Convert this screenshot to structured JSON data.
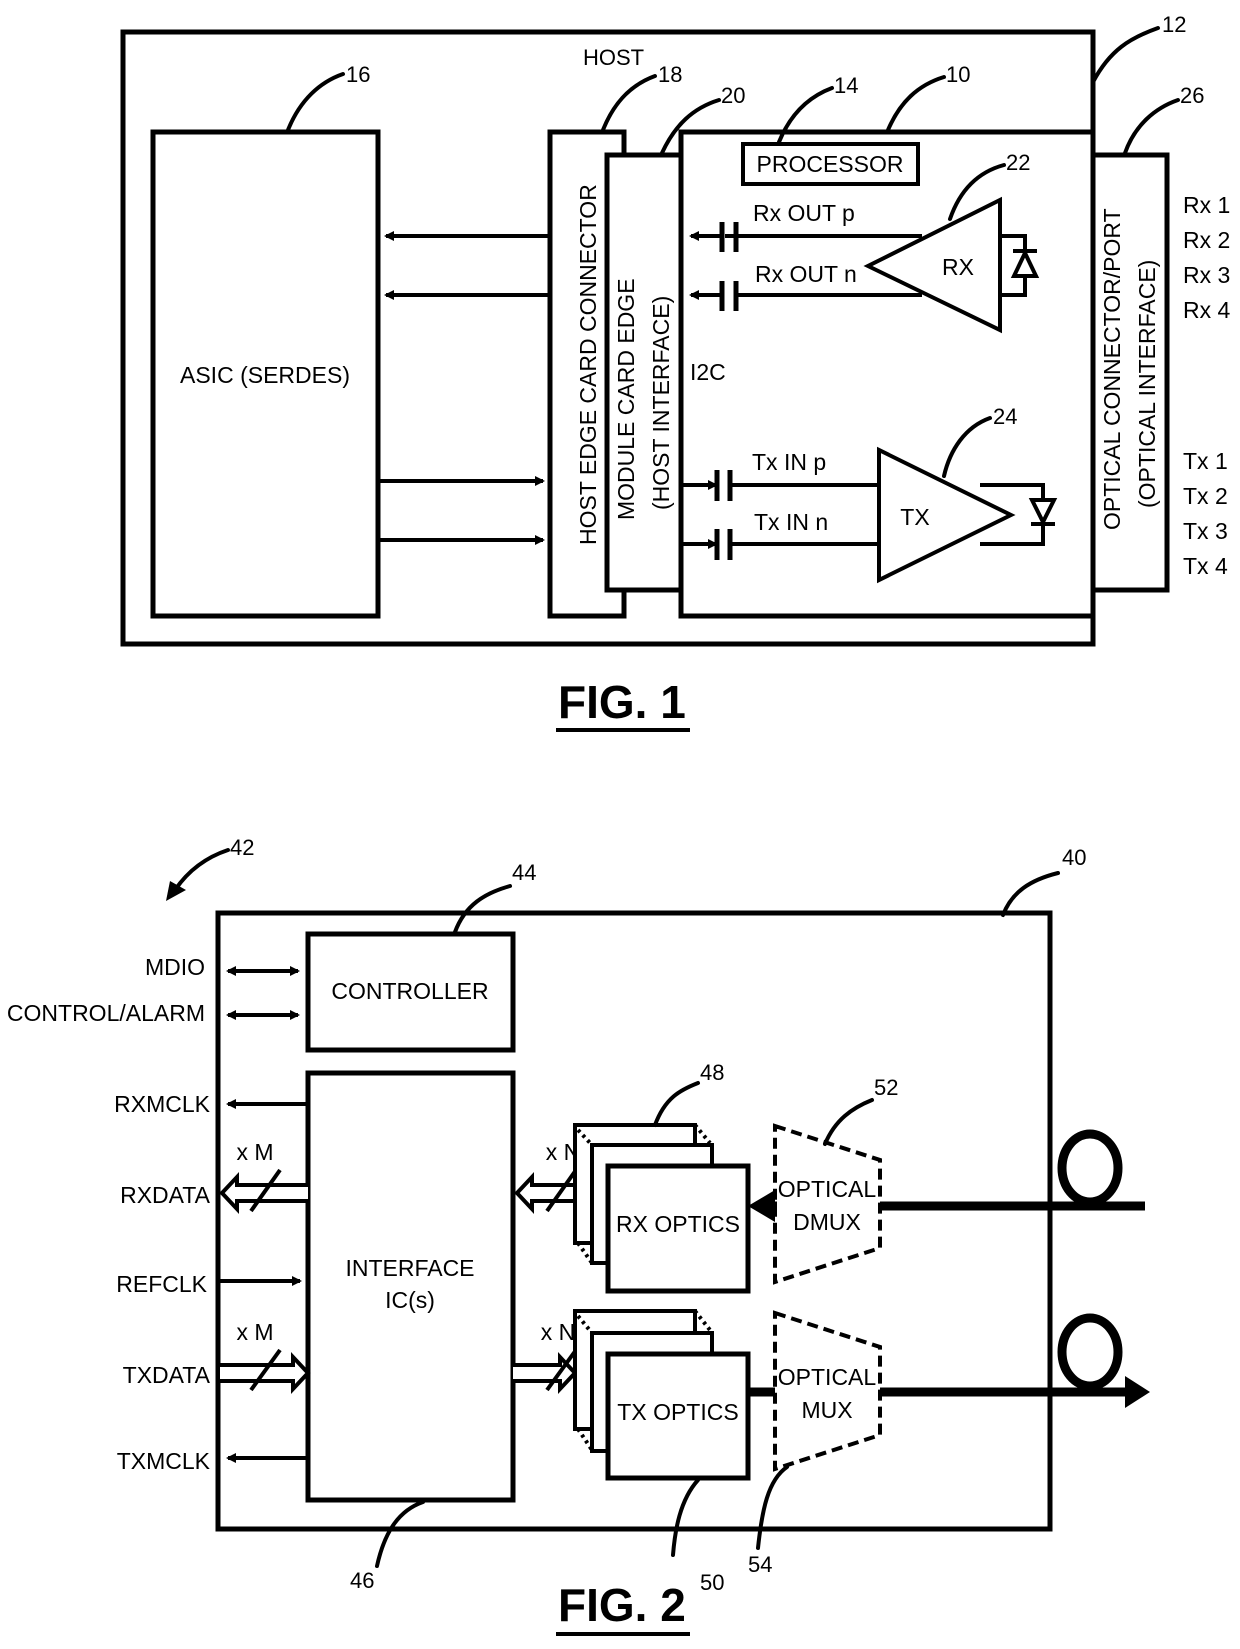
{
  "figure1": {
    "caption": "FIG. 1",
    "host_label": "HOST",
    "asic_label": "ASIC (SERDES)",
    "host_edge_connector_label": "HOST EDGE CARD CONNECTOR",
    "module_card_edge_label_1": "MODULE CARD EDGE",
    "module_card_edge_label_2": "(HOST INTERFACE)",
    "processor_label": "PROCESSOR",
    "i2c_label": "I2C",
    "rx_out_p": "Rx OUT p",
    "rx_out_n": "Rx OUT n",
    "rx_label": "RX",
    "tx_in_p": "Tx IN p",
    "tx_in_n": "Tx IN n",
    "tx_label": "TX",
    "optical_port_label_1": "OPTICAL CONNECTOR/PORT",
    "optical_port_label_2": "(OPTICAL INTERFACE)",
    "rx_channels": [
      "Rx 1",
      "Rx 2",
      "Rx 3",
      "Rx 4"
    ],
    "tx_channels": [
      "Tx 1",
      "Tx 2",
      "Tx 3",
      "Tx 4"
    ],
    "refs": {
      "host": "12",
      "module": "10",
      "processor": "14",
      "asic": "16",
      "host_connector": "18",
      "module_edge": "20",
      "rx": "22",
      "tx": "24",
      "optical_port": "26"
    }
  },
  "figure2": {
    "caption": "FIG. 2",
    "controller_label": "CONTROLLER",
    "interface_label_1": "INTERFACE",
    "interface_label_2": "IC(s)",
    "rx_optics_label": "RX OPTICS",
    "tx_optics_label": "TX OPTICS",
    "dmux_label_1": "OPTICAL",
    "dmux_label_2": "DMUX",
    "mux_label_1": "OPTICAL",
    "mux_label_2": "MUX",
    "signals": {
      "mdio": "MDIO",
      "control_alarm": "CONTROL/ALARM",
      "rxmclk": "RXMCLK",
      "rxdata": "RXDATA",
      "refclk": "REFCLK",
      "txdata": "TXDATA",
      "txmclk": "TXMCLK"
    },
    "bus_m": "x M",
    "bus_n": "x N",
    "refs": {
      "module": "40",
      "system": "42",
      "controller": "44",
      "interface": "46",
      "rx_optics": "48",
      "tx_optics": "50",
      "dmux": "52",
      "mux": "54"
    }
  }
}
